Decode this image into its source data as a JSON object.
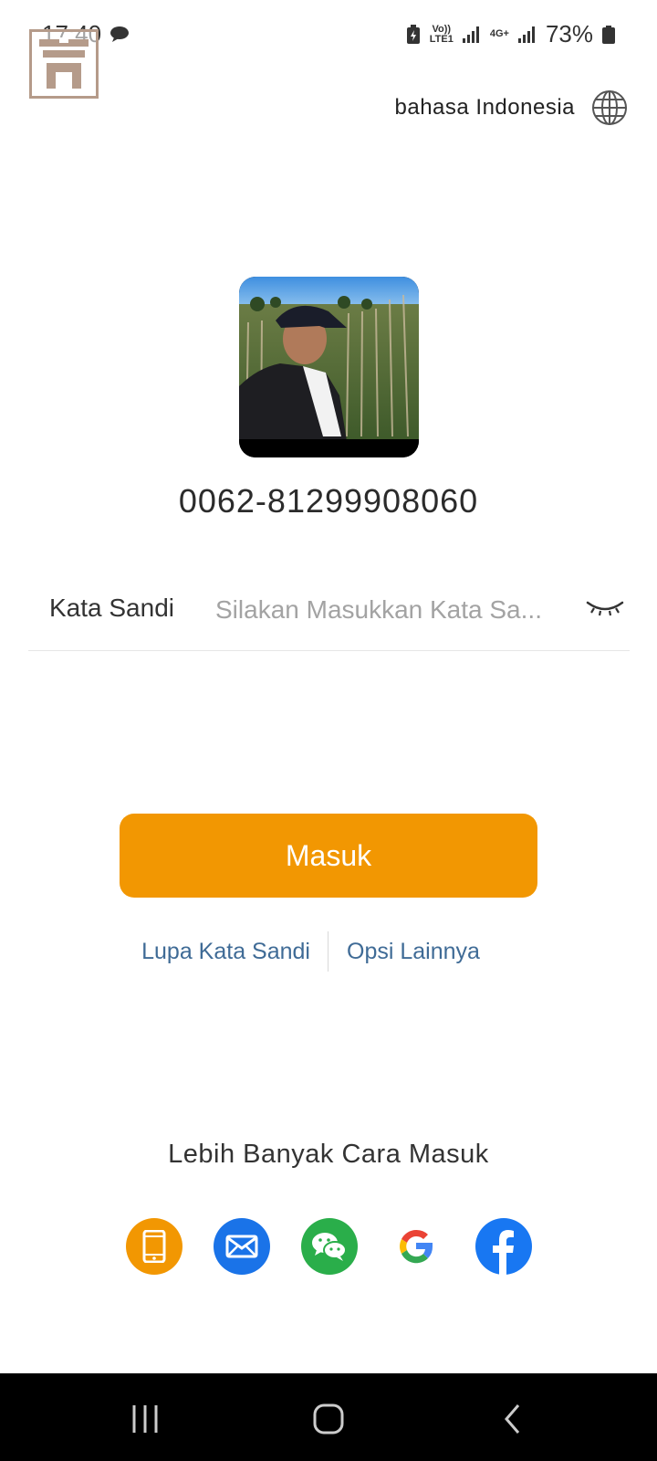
{
  "status_bar": {
    "time": "17:40",
    "network_label": "Vo)) LTE1",
    "network_type": "4G+",
    "battery_percent": "73%"
  },
  "language": {
    "label": "bahasa Indonesia",
    "icon": "globe-icon"
  },
  "account": {
    "phone": "0062-81299908060"
  },
  "password": {
    "label": "Kata Sandi",
    "placeholder": "Silakan Masukkan Kata Sa...",
    "value": ""
  },
  "actions": {
    "login": "Masuk",
    "forgot_password": "Lupa Kata Sandi",
    "more_options": "Opsi Lainnya"
  },
  "more_login": {
    "title": "Lebih Banyak Cara Masuk",
    "methods": [
      {
        "name": "phone",
        "icon": "phone-icon",
        "color": "#f29702"
      },
      {
        "name": "email",
        "icon": "mail-icon",
        "color": "#1a73e8"
      },
      {
        "name": "wechat",
        "icon": "wechat-icon",
        "color": "#2aae4a"
      },
      {
        "name": "google",
        "icon": "google-icon",
        "color": "#ffffff"
      },
      {
        "name": "facebook",
        "icon": "facebook-icon",
        "color": "#1877f2"
      }
    ]
  },
  "colors": {
    "accent": "#f29702",
    "link": "#3f6b96",
    "placeholder": "#a3a3a3",
    "divider": "#e6e6e6"
  }
}
